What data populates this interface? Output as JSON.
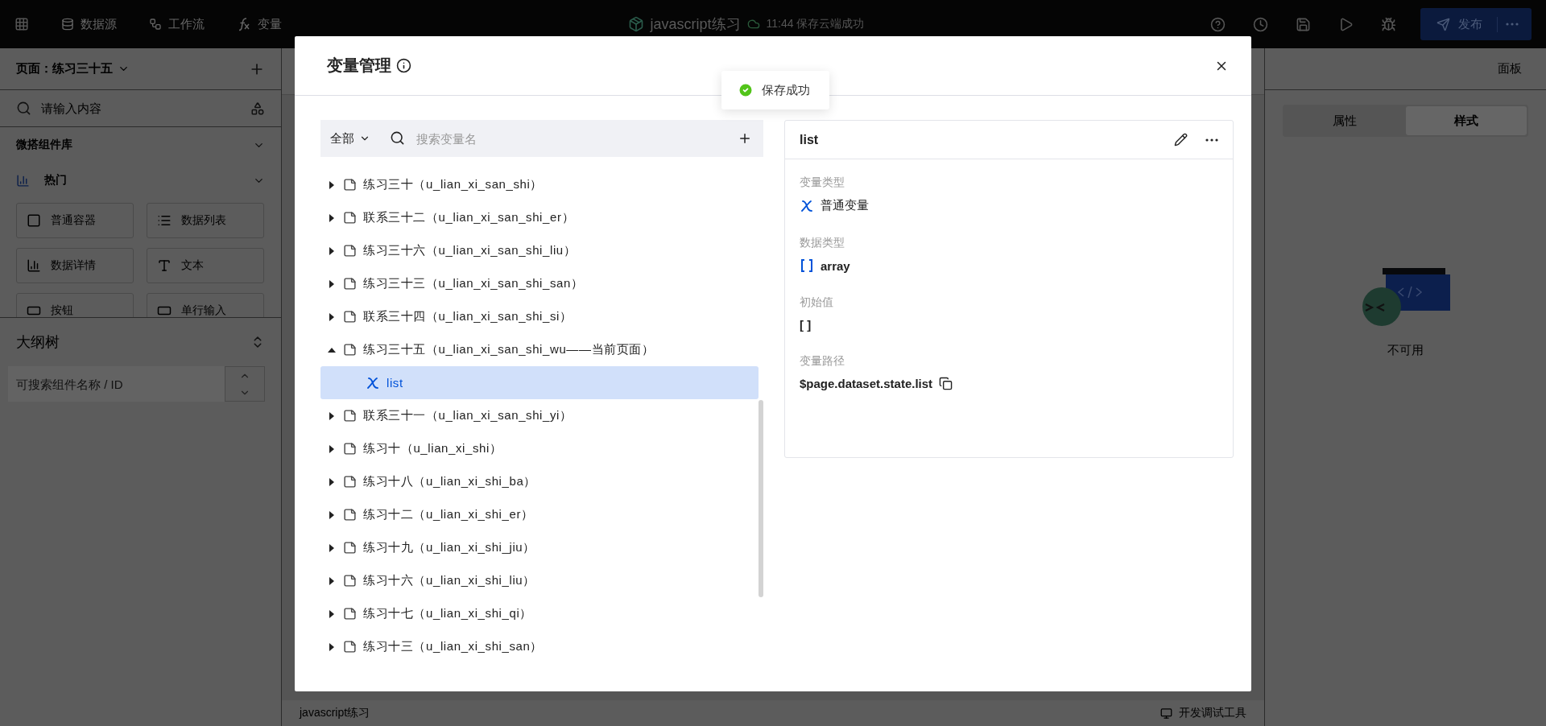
{
  "topbar": {
    "nav": [
      {
        "label": "数据源",
        "kind": "database"
      },
      {
        "label": "工作流",
        "kind": "workflow"
      },
      {
        "label": "变量",
        "kind": "function"
      }
    ],
    "title": "javascript练习",
    "save_status": "11:44 保存云端成功",
    "publish": "发布"
  },
  "left_panel": {
    "page_selector": "页面：练习三十五",
    "search_placeholder": "请输入内容",
    "library_title": "微搭组件库",
    "category": "热门",
    "components": [
      {
        "label": "普通容器",
        "kind": "container"
      },
      {
        "label": "数据列表",
        "kind": "list"
      },
      {
        "label": "数据详情",
        "kind": "detail"
      },
      {
        "label": "文本",
        "kind": "text"
      },
      {
        "label": "按钮",
        "kind": "button"
      },
      {
        "label": "单行输入",
        "kind": "input"
      }
    ],
    "outline_title": "大纲树",
    "outline_search_placeholder": "可搜索组件名称 / ID"
  },
  "right_panel": {
    "title": "面板",
    "tabs": [
      {
        "label": "属性",
        "selected": false
      },
      {
        "label": "样式",
        "selected": true
      }
    ],
    "empty_text": "不可用"
  },
  "bottom_bar": {
    "app_name": "javascript练习",
    "debug_tool": "开发调试工具"
  },
  "toast": {
    "text": "保存成功"
  },
  "modal": {
    "title": "变量管理",
    "filter": "全部",
    "search_placeholder": "搜索变量名",
    "tree": [
      {
        "label": "练习三十（u_lian_xi_san_shi）",
        "expanded": false
      },
      {
        "label": "联系三十二（u_lian_xi_san_shi_er）",
        "expanded": false
      },
      {
        "label": "练习三十六（u_lian_xi_san_shi_liu）",
        "expanded": false
      },
      {
        "label": "练习三十三（u_lian_xi_san_shi_san）",
        "expanded": false
      },
      {
        "label": "联系三十四（u_lian_xi_san_shi_si）",
        "expanded": false
      },
      {
        "label": "练习三十五（u_lian_xi_san_shi_wu——当前页面）",
        "expanded": true,
        "children": [
          {
            "label": "list",
            "selected": true
          }
        ]
      },
      {
        "label": "联系三十一（u_lian_xi_san_shi_yi）",
        "expanded": false
      },
      {
        "label": "练习十（u_lian_xi_shi）",
        "expanded": false
      },
      {
        "label": "练习十八（u_lian_xi_shi_ba）",
        "expanded": false
      },
      {
        "label": "练习十二（u_lian_xi_shi_er）",
        "expanded": false
      },
      {
        "label": "练习十九（u_lian_xi_shi_jiu）",
        "expanded": false
      },
      {
        "label": "练习十六（u_lian_xi_shi_liu）",
        "expanded": false
      },
      {
        "label": "练习十七（u_lian_xi_shi_qi）",
        "expanded": false
      },
      {
        "label": "练习十三（u_lian_xi_shi_san）",
        "expanded": false
      }
    ],
    "detail": {
      "name": "list",
      "fields": [
        {
          "label": "变量类型",
          "value": "普通变量",
          "kind": "variable"
        },
        {
          "label": "数据类型",
          "value": "array",
          "kind": "array"
        },
        {
          "label": "初始值",
          "value": "[ ]",
          "kind": "plain"
        },
        {
          "label": "变量路径",
          "value": "$page.dataset.state.list",
          "kind": "path"
        }
      ]
    }
  }
}
